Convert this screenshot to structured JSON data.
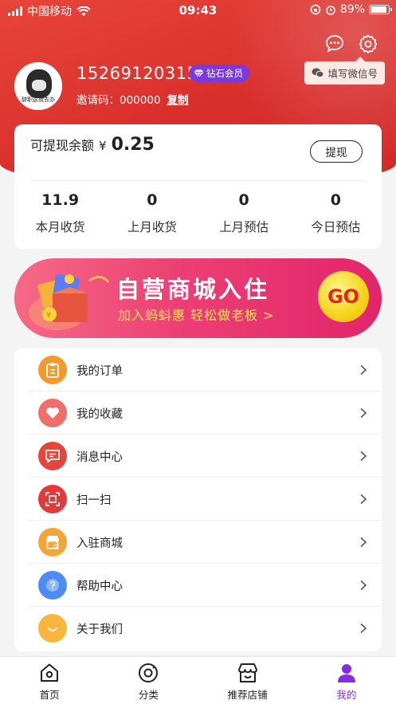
{
  "status_bar": {
    "carrier": "中国移动",
    "time": "09:43",
    "battery_percent": "89%",
    "battery_level": 0.89
  },
  "profile": {
    "phone": "15269120315",
    "vip_label": "钻石会员",
    "invite_label": "邀请码：",
    "invite_code": "000000",
    "copy_label": "复制",
    "wechat_tip": "填写微信号",
    "avatar_caption": "辞职这就去办"
  },
  "balance": {
    "label": "可提现余额",
    "currency": "¥",
    "amount": "0.25",
    "withdraw_label": "提现",
    "stats": [
      {
        "value": "11.9",
        "name": "本月收货"
      },
      {
        "value": "0",
        "name": "上月收货"
      },
      {
        "value": "0",
        "name": "上月预估"
      },
      {
        "value": "0",
        "name": "今日预估"
      }
    ]
  },
  "banner": {
    "title": "自营商城入住",
    "subtitle": "加入蚂蚪惠  轻松做老板 >",
    "go_label": "GO"
  },
  "menu": {
    "items": [
      {
        "label": "我的订单",
        "icon": "order-icon",
        "color": "#f39a2e"
      },
      {
        "label": "我的收藏",
        "icon": "heart-icon",
        "color": "#f06f6a"
      },
      {
        "label": "消息中心",
        "icon": "message-icon",
        "color": "#e4463c"
      },
      {
        "label": "扫一扫",
        "icon": "scan-icon",
        "color": "#e23a3a"
      },
      {
        "label": "入驻商城",
        "icon": "store-icon",
        "color": "#f3a53a"
      },
      {
        "label": "帮助中心",
        "icon": "help-icon",
        "color": "#4e8cf5"
      },
      {
        "label": "关于我们",
        "icon": "smile-icon",
        "color": "#f6b73c"
      }
    ]
  },
  "tabbar": {
    "tabs": [
      {
        "label": "首页",
        "icon": "home-icon"
      },
      {
        "label": "分类",
        "icon": "category-icon"
      },
      {
        "label": "推荐店铺",
        "icon": "shop-icon"
      },
      {
        "label": "我的",
        "icon": "profile-icon",
        "active": true
      }
    ],
    "active_color": "#8a2be2"
  },
  "colors": {
    "header": "#d92f2c",
    "vip": "#7b3bdc",
    "banner": "#ec3f74"
  }
}
